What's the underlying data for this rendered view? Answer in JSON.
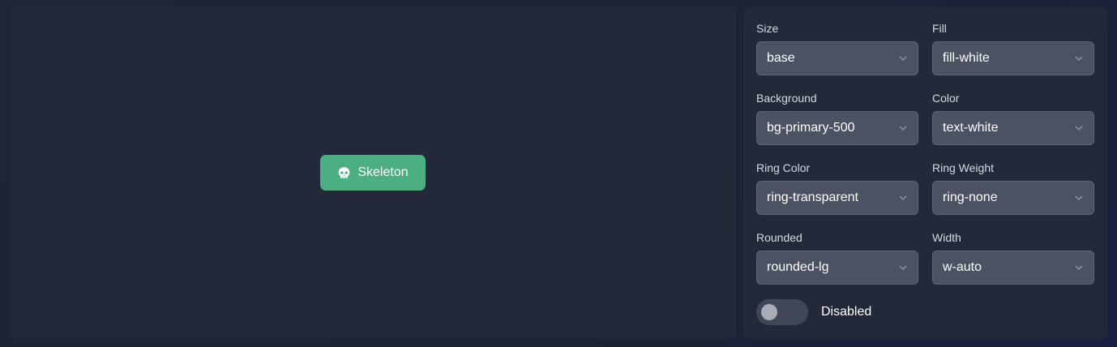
{
  "preview": {
    "button": {
      "icon": "skull-icon",
      "label": "Skeleton",
      "bg_color": "#4caf82"
    }
  },
  "settings": {
    "size": {
      "label": "Size",
      "value": "base"
    },
    "fill": {
      "label": "Fill",
      "value": "fill-white"
    },
    "background": {
      "label": "Background",
      "value": "bg-primary-500"
    },
    "color": {
      "label": "Color",
      "value": "text-white"
    },
    "ring_color": {
      "label": "Ring Color",
      "value": "ring-transparent"
    },
    "ring_weight": {
      "label": "Ring Weight",
      "value": "ring-none"
    },
    "rounded": {
      "label": "Rounded",
      "value": "rounded-lg"
    },
    "width": {
      "label": "Width",
      "value": "w-auto"
    },
    "disabled": {
      "label": "Disabled",
      "checked": false
    }
  },
  "icons": {
    "dropdown": "chevron-down-icon"
  }
}
